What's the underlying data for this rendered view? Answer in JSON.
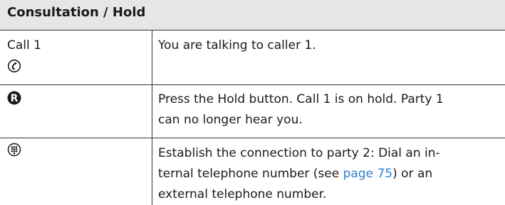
{
  "title": "Consultation / Hold",
  "rows": [
    {
      "left_text": "Call 1",
      "left_icon": "handset-icon",
      "right_lines": [
        "You are talking to caller 1."
      ]
    },
    {
      "left_icon": "recall-r-icon",
      "right_lines": [
        "Press the Hold button. Call 1 is on hold. Party 1",
        "can no longer hear you."
      ]
    },
    {
      "left_icon": "keypad-icon",
      "right_line1": "Establish the connection to party 2: Dial an in-",
      "right_line2_before": "ternal telephone number (see ",
      "right_line2_link": "page 75",
      "right_line2_after": ") or an",
      "right_line3": "external telephone number."
    }
  ]
}
